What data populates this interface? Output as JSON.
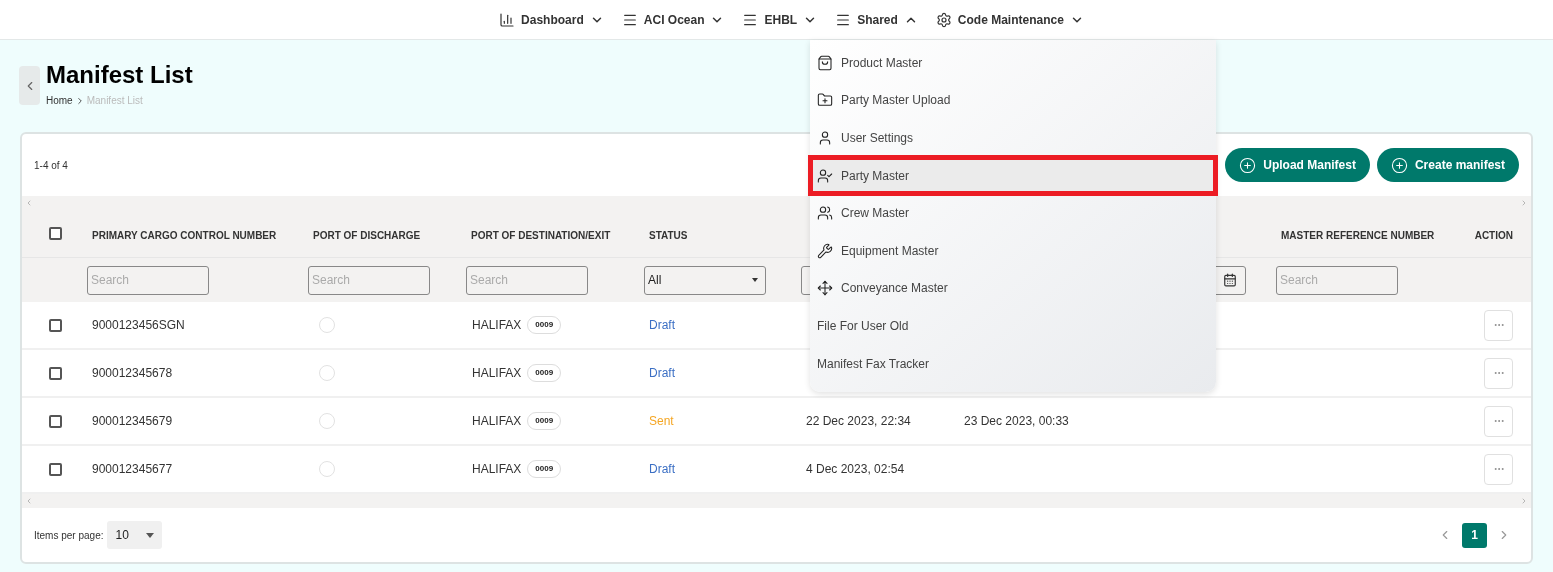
{
  "nav": [
    {
      "label": "Dashboard",
      "expanded": false
    },
    {
      "label": "ACI Ocean",
      "expanded": false
    },
    {
      "label": "EHBL",
      "expanded": false
    },
    {
      "label": "Shared",
      "expanded": true
    },
    {
      "label": "Code Maintenance",
      "expanded": false
    }
  ],
  "menu": [
    {
      "label": "Product Master",
      "kind": "icon",
      "highlighted": false
    },
    {
      "label": "Party Master Upload",
      "kind": "icon",
      "highlighted": false
    },
    {
      "label": "User Settings",
      "kind": "icon",
      "highlighted": false
    },
    {
      "label": "Party Master",
      "kind": "icon",
      "highlighted": true
    },
    {
      "label": "Crew Master",
      "kind": "icon",
      "highlighted": false
    },
    {
      "label": "Equipment Master",
      "kind": "icon",
      "highlighted": false
    },
    {
      "label": "Conveyance Master",
      "kind": "icon",
      "highlighted": false
    },
    {
      "label": "File For User Old",
      "kind": "plain",
      "highlighted": false
    },
    {
      "label": "Manifest Fax Tracker",
      "kind": "plain",
      "highlighted": false
    }
  ],
  "page": {
    "title": "Manifest List",
    "breadcrumb": [
      "Home",
      "Manifest List"
    ]
  },
  "toolbar": {
    "count": "1-4 of 4",
    "buttons": [
      "Upload Manifest",
      "Create manifest"
    ]
  },
  "table": {
    "columns": [
      {
        "label": "PRIMARY CARGO CONTROL NUMBER"
      },
      {
        "label": "PORT OF DISCHARGE"
      },
      {
        "label": "PORT OF DESTINATION/EXIT"
      },
      {
        "label": "STATUS"
      },
      {},
      {},
      {
        "label": "MASTER REFERENCE NUMBER"
      },
      {
        "label": "ACTION"
      }
    ],
    "all_checked": false,
    "filters": [
      {
        "kind": "search",
        "placeholder": "Search"
      },
      {
        "kind": "search",
        "placeholder": "Search"
      },
      {
        "kind": "search",
        "placeholder": "Search"
      },
      {
        "kind": "select",
        "value": "All"
      },
      {
        "kind": "search"
      },
      {
        "kind": "date"
      },
      {
        "kind": "search",
        "placeholder": "Search"
      }
    ],
    "rows": [
      {
        "checked": false,
        "number": "9000123456SGN",
        "port": "HALIFAX",
        "code": "0009",
        "status": "Draft",
        "kind": "draft"
      },
      {
        "checked": false,
        "number": "900012345678",
        "port": "HALIFAX",
        "code": "0009",
        "status": "Draft",
        "kind": "draft"
      },
      {
        "checked": false,
        "number": "900012345679",
        "port": "HALIFAX",
        "code": "0009",
        "status": "Sent",
        "kind": "sent",
        "date_1": "22 Dec 2023, 22:34",
        "date_2": "23 Dec 2023, 00:33"
      },
      {
        "checked": false,
        "number": "900012345677",
        "port": "HALIFAX",
        "code": "0009",
        "status": "Draft",
        "kind": "draft",
        "date_1": "4 Dec 2023, 02:54"
      }
    ]
  },
  "footer": {
    "items_label": "Items per page:",
    "items_value": "10",
    "pages": [
      {
        "label": "1",
        "selected": true
      }
    ]
  }
}
